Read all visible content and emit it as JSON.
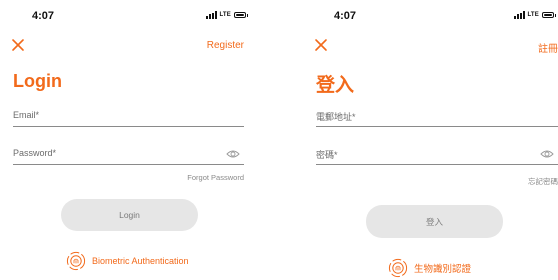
{
  "colors": {
    "accent": "#f26a1b",
    "field_label": "#6b6b6b",
    "button_bg": "#e6e6e6",
    "button_text": "#7a7a7a"
  },
  "screens": [
    {
      "language": "en",
      "status_bar": {
        "time": "4:07",
        "network": "LTE"
      },
      "close_icon": "close-icon",
      "register_label": "Register",
      "title": "Login",
      "email_placeholder": "Email*",
      "password_placeholder": "Password*",
      "forgot_label": "Forgot Password",
      "login_label": "Login",
      "biometric_label": "Biometric Authentication"
    },
    {
      "language": "zh-Hant",
      "status_bar": {
        "time": "4:07",
        "network": "LTE"
      },
      "close_icon": "close-icon",
      "register_label": "註冊",
      "title": "登入",
      "email_placeholder": "電郵地址*",
      "password_placeholder": "密碼*",
      "forgot_label": "忘記密碼",
      "login_label": "登入",
      "biometric_label": "生物識別認證"
    }
  ]
}
